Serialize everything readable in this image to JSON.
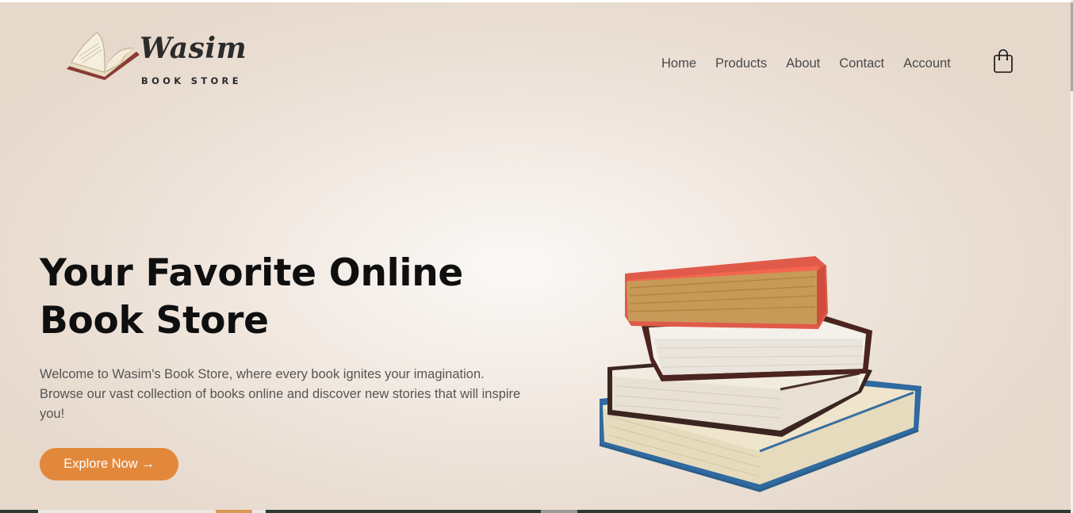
{
  "brand": {
    "name": "Wasim",
    "tagline": "BOOK STORE"
  },
  "nav": {
    "items": [
      {
        "label": "Home"
      },
      {
        "label": "Products"
      },
      {
        "label": "About"
      },
      {
        "label": "Contact"
      },
      {
        "label": "Account"
      }
    ],
    "cart_icon": "shopping-bag-icon"
  },
  "hero": {
    "title_line1": "Your Favorite Online",
    "title_line2": "Book Store",
    "description": "Welcome to Wasim's Book Store, where every book ignites your imagination. Browse our vast collection of books online and discover new stories that will inspire you!",
    "cta_label": "Explore Now →",
    "image_icon": "book-stack-illustration"
  },
  "colors": {
    "accent": "#e2883b",
    "text_dark": "#0f0f0f",
    "text_muted": "#555555",
    "background": "#efe5dc"
  }
}
